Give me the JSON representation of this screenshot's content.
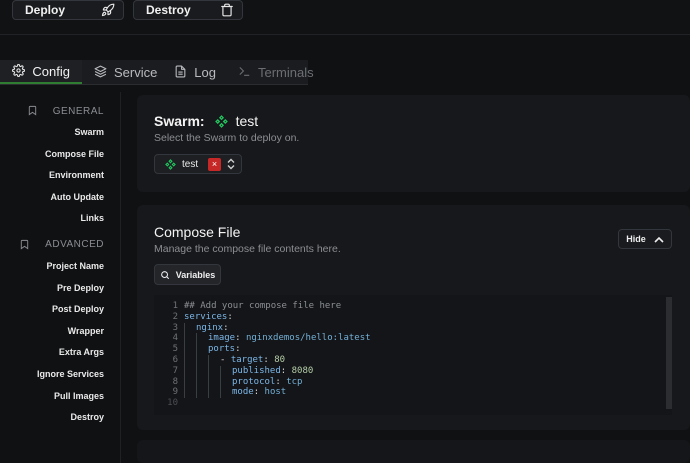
{
  "actions": {
    "deploy_label": "Deploy",
    "destroy_label": "Destroy"
  },
  "tabs": [
    {
      "label": "Config",
      "icon": "gear-icon",
      "active": true
    },
    {
      "label": "Services",
      "icon": "layers-icon"
    },
    {
      "label": "Log",
      "icon": "file-text-icon"
    },
    {
      "label": "Terminals",
      "icon": "terminal-icon",
      "disabled": true
    }
  ],
  "sidebar": {
    "general_heading": "GENERAL",
    "general_items": [
      "Swarm",
      "Compose File",
      "Environment",
      "Auto Update",
      "Links"
    ],
    "advanced_heading": "ADVANCED",
    "advanced_items": [
      "Project Name",
      "Pre Deploy",
      "Post Deploy",
      "Wrapper",
      "Extra Args",
      "Ignore Services",
      "Pull Images",
      "Destroy"
    ]
  },
  "swarm": {
    "title_prefix": "Swarm:",
    "title_value": "test",
    "subtitle": "Select the Swarm to deploy on.",
    "selected": "test",
    "clear_symbol": "×"
  },
  "compose": {
    "title": "Compose File",
    "subtitle": "Manage the compose file contents here.",
    "hide_label": "Hide",
    "variables_label": "Variables",
    "line_numbers": [
      "1",
      "2",
      "3",
      "4",
      "5",
      "6",
      "7",
      "8",
      "9",
      "10"
    ],
    "code": {
      "l1": "## Add your compose file here",
      "l2k": "services",
      "l3k": "nginx",
      "l4k": "image",
      "l4v": "nginxdemos/hello:latest",
      "l5k": "ports",
      "l6k": "target",
      "l6v": "80",
      "l7k": "published",
      "l7v": "8080",
      "l8k": "protocol",
      "l8v": "tcp",
      "l9k": "mode",
      "l9v": "host",
      "colon": ":",
      "dash": "- "
    }
  },
  "colors": {
    "accent": "#2e7d32",
    "swarm_icon": "#22c55e",
    "danger": "#c62828"
  }
}
